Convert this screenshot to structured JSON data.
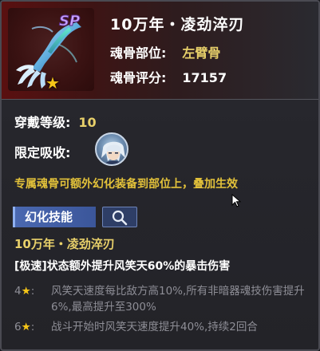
{
  "header": {
    "icon_badge": "SP",
    "icon_name": "bone-claw-icon",
    "star_count": 1,
    "title": "10万年・凌劲淬刃",
    "part_label": "魂骨部位:",
    "part_value": "左臂骨",
    "score_label": "魂骨评分:",
    "score_value": "17157"
  },
  "body": {
    "wear_label": "穿戴等级:",
    "wear_value": "10",
    "absorb_label": "限定吸收:",
    "absorb_avatar": "character-avatar",
    "note": "专属魂骨可额外幻化装备到部位上，叠加生效"
  },
  "skill": {
    "tab_label": "幻化技能",
    "search_icon": "magnifier-icon",
    "name": "10万年・凌劲淬刃",
    "desc": "[极速]状态额外提升风笑天60%的暴击伤害",
    "levels": [
      {
        "level": "4",
        "star": "★",
        "sep": ":",
        "text": "风笑天速度每比敌方高10%,所有非暗器魂技伤害提升6%,最高提升至300%"
      },
      {
        "level": "6",
        "star": "★",
        "sep": ":",
        "text": "战斗开始时风笑天速度提升40%,持续2回合"
      }
    ]
  },
  "colors": {
    "gold_text": "#e8d06a",
    "note_text": "#e3c23a",
    "tab_blue": "#4a68b0",
    "dim_text": "#8e8e96"
  }
}
